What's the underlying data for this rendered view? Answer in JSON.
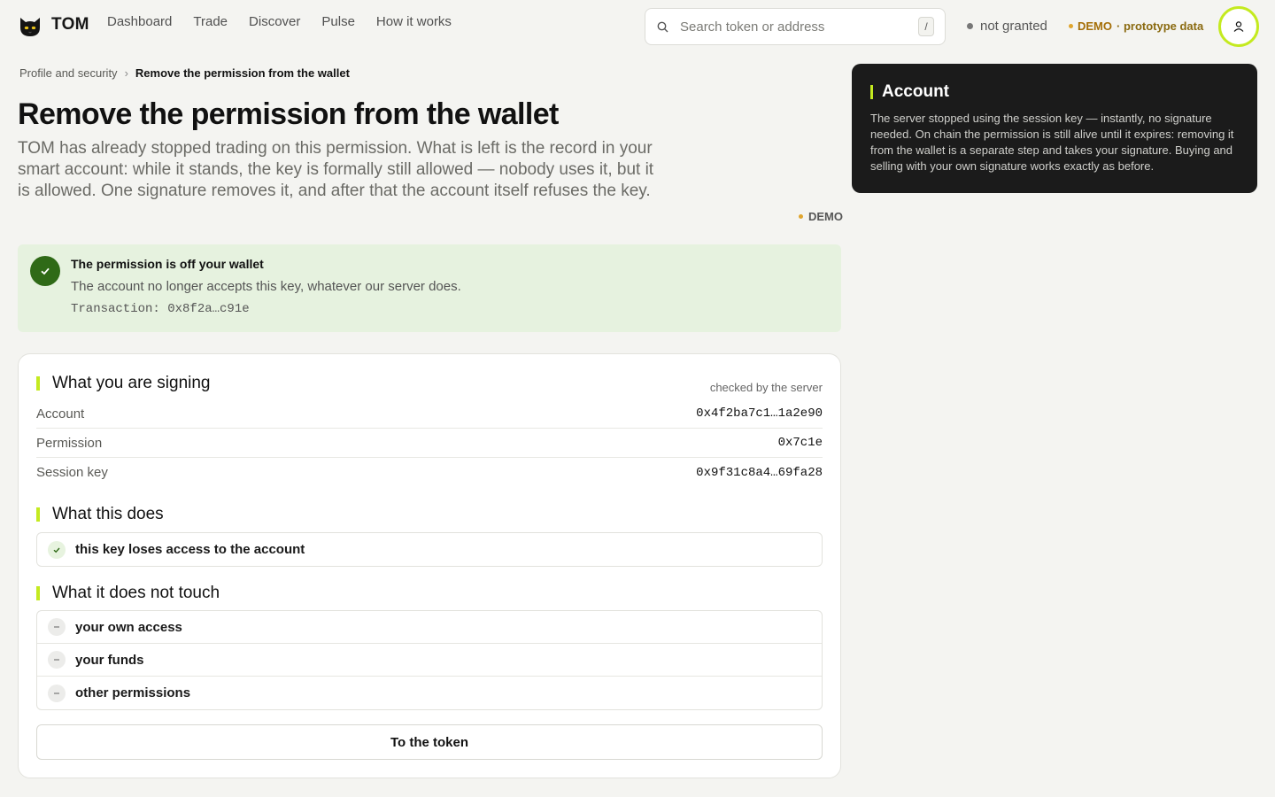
{
  "brand": {
    "name": "TOM"
  },
  "nav": [
    "Dashboard",
    "Trade",
    "Discover",
    "Pulse",
    "How it works"
  ],
  "search": {
    "placeholder": "Search token or address",
    "shortcut": "/"
  },
  "status": {
    "label": "not granted"
  },
  "demo_badge": {
    "label": "DEMO",
    "sub": "· prototype data"
  },
  "breadcrumb": {
    "parent": "Profile and security",
    "separator": "›",
    "current": "Remove the permission from the wallet"
  },
  "page": {
    "title": "Remove the permission from the wallet",
    "lead": "TOM has already stopped trading on this permission. What is left is the record in your smart account: while it stands, the key is formally still allowed — nobody uses it, but it is allowed. One signature removes it, and after that the account itself refuses the key.",
    "demo_label": "DEMO"
  },
  "success": {
    "title": "The permission is off your wallet",
    "desc": "The account no longer accepts this key, whatever our server does.",
    "tx": "Transaction: 0x8f2a…c91e"
  },
  "signing": {
    "title": "What you are signing",
    "checked": "checked by the server",
    "rows": [
      {
        "k": "Account",
        "v": "0x4f2ba7c1…1a2e90"
      },
      {
        "k": "Permission",
        "v": "0x7c1e"
      },
      {
        "k": "Session key",
        "v": "0x9f31c8a4…69fa28"
      }
    ]
  },
  "does": {
    "title": "What this does",
    "items": [
      "this key loses access to the account"
    ]
  },
  "does_not": {
    "title": "What it does not touch",
    "items": [
      "your own access",
      "your funds",
      "other permissions"
    ]
  },
  "cta": {
    "label": "To the token"
  },
  "aside": {
    "title": "Account",
    "body": "The server stopped using the session key — instantly, no signature needed. On chain the permission is still alive until it expires: removing it from the wallet is a separate step and takes your signature. Buying and selling with your own signature works exactly as before."
  },
  "colors": {
    "accent": "#c4ea1f",
    "success_bg": "#e6f2df",
    "success_icon": "#2f6a17",
    "demo": "#e0a52e",
    "dark_panel": "#1b1b1b"
  }
}
